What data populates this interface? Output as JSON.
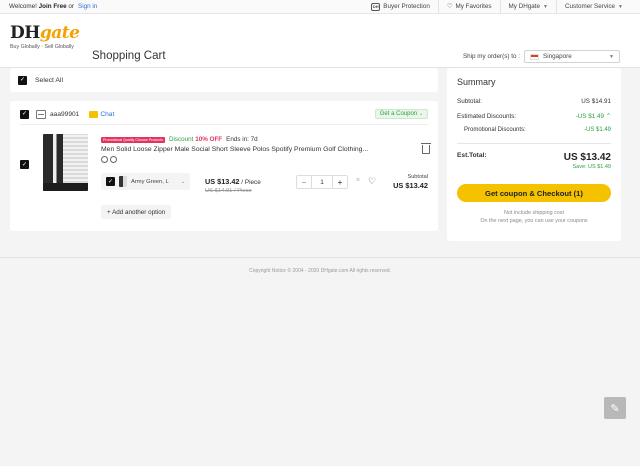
{
  "topbar": {
    "welcome": "Welcome!",
    "join_free": "Join Free",
    "or": "or",
    "sign_in": "Sign in",
    "buyer_protection": "Buyer Protection",
    "my_favorites": "My Favorites",
    "my_dhgate": "My DHgate",
    "customer_service": "Customer Service"
  },
  "header": {
    "logo_dh": "DH",
    "logo_gate": "gate",
    "logo_tagline": "Buy Globally · Sell Globally",
    "page_title": "Shopping Cart",
    "ship_label": "Ship my order(s) to :",
    "ship_country": "Singapore"
  },
  "cart": {
    "select_all_label": "Select All",
    "shop": {
      "name": "aaa99901",
      "chat_label": "Chat",
      "coupon_label": "Get a Coupon"
    },
    "item": {
      "promo_badge": "Promotional Quality Choose Products",
      "discount_text": "Discount",
      "discount_pct": "10% OFF",
      "ends_in": "Ends in: 7d",
      "title": "Men Solid Loose Zipper Male Social Short Sleeve Polos Spotify Premium Golf Clothing...",
      "variant": "Army Green, L",
      "price_now": "US $13.42",
      "price_unit": "/ Piece",
      "price_was": "US $14.91 / Piece",
      "quantity": "1",
      "minus": "−",
      "plus": "+",
      "remove": "×",
      "subtotal_label": "Subtotal",
      "subtotal_value": "US $13.42",
      "add_option": "+ Add another option"
    }
  },
  "summary": {
    "title": "Summary",
    "subtotal_label": "Subtotal:",
    "subtotal_value": "US $14.91",
    "est_discounts_label": "Estimated Discounts:",
    "est_discounts_value": "-US $1.49",
    "promo_discounts_label": "Promotional Discounts:",
    "promo_discounts_value": "-US $1.49",
    "est_total_label": "Est.Total:",
    "est_total_value": "US $13.42",
    "save_line": "Save: US $1.49",
    "checkout_button": "Get coupon & Checkout (1)",
    "note_line1": "Not include shipping cost",
    "note_line2": "On the next page, you can use your coupons"
  },
  "footer": {
    "copyright": "Copyright Notice © 2004 - 2020 DHgate.com All rights reserved."
  },
  "colors": {
    "accent_yellow": "#f5c200",
    "discount_green": "#2ea044",
    "promo_pink": "#e2345e",
    "link_blue": "#2b6fd6"
  }
}
